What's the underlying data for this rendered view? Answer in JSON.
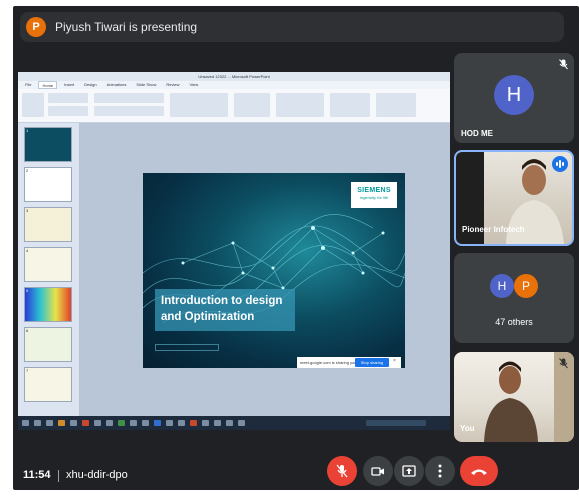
{
  "presenter_banner": {
    "initial": "P",
    "text": "Piyush Tiwari is presenting",
    "avatar_color": "#e8710a"
  },
  "shared_screen": {
    "window_title": "Unsaved 12322 ... Microsoft PowerPoint",
    "ribbon_tabs": [
      "File",
      "Home",
      "Insert",
      "Design",
      "Animations",
      "Slide Show",
      "Review",
      "View"
    ],
    "slide": {
      "brand": "SIEMENS",
      "brand_tagline": "Ingenuity for life",
      "title_line1": "Introduction to design",
      "title_line2": "and Optimization",
      "share_notice": "meet.google.com is sharing your screen.",
      "stop_sharing_label": "Stop sharing",
      "close_glyph": "×"
    },
    "thumbnails": [
      "1",
      "2",
      "3",
      "4",
      "5",
      "6",
      "7"
    ]
  },
  "participants": [
    {
      "name": "HOD ME",
      "initial": "H",
      "muted": true,
      "avatar_color": "#4f63c9"
    },
    {
      "name": "Pioneer Infotech",
      "speaking": true
    },
    {
      "name": "47 others",
      "initials": [
        "H",
        "P"
      ],
      "avatar_colors": [
        "#4f63c9",
        "#e8710a"
      ]
    },
    {
      "name": "You",
      "muted": true
    }
  ],
  "bottom_bar": {
    "time": "11:54",
    "meeting_code": "xhu-ddir-dpo",
    "controls": [
      "mic-off-icon",
      "camera-icon",
      "present-icon",
      "more-icon",
      "end-call-icon"
    ]
  },
  "colors": {
    "meet_bg": "#202124",
    "accent_red": "#ea4335",
    "accent_blue": "#1a73e8"
  }
}
